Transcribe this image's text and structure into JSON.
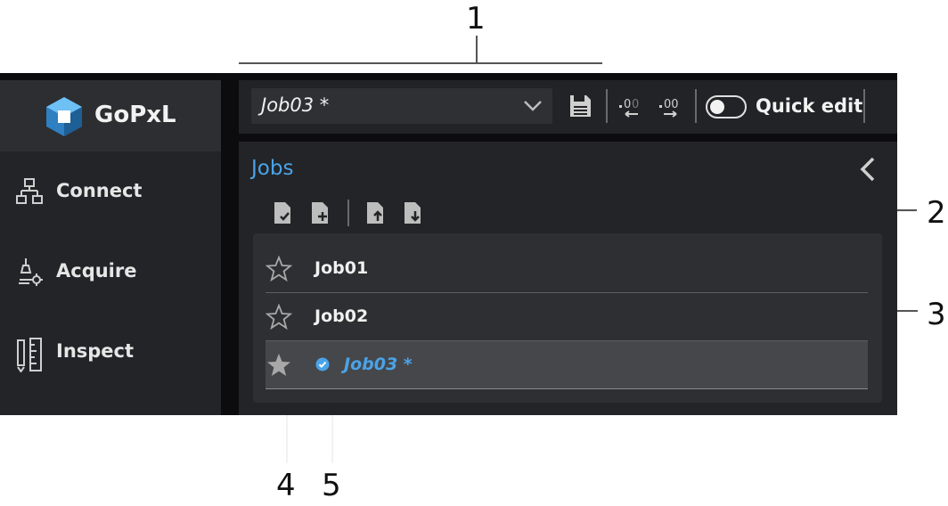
{
  "app": {
    "name": "GoPxL"
  },
  "sidebar": {
    "items": [
      {
        "label": "Connect",
        "icon": "network-icon"
      },
      {
        "label": "Acquire",
        "icon": "scanner-gear-icon"
      },
      {
        "label": "Inspect",
        "icon": "ruler-icon"
      }
    ]
  },
  "toolbar": {
    "job_select_value": "Job03 *",
    "quick_edit_label": "Quick edit",
    "quick_edit_on": false
  },
  "jobs_panel": {
    "title": "Jobs",
    "toolbar_icons": [
      "job-save-icon",
      "job-new-icon",
      "job-upload-icon",
      "job-download-icon"
    ],
    "jobs": [
      {
        "name": "Job01",
        "favorite": false,
        "active": false
      },
      {
        "name": "Job02",
        "favorite": false,
        "active": false
      },
      {
        "name": "Job03 *",
        "favorite": true,
        "active": true
      }
    ]
  },
  "callouts": [
    "1",
    "2",
    "3",
    "4",
    "5"
  ],
  "colors": {
    "accent": "#4aa3e8",
    "sidebar": "#232427",
    "panel": "#232427",
    "selected_row": "#46474a"
  }
}
